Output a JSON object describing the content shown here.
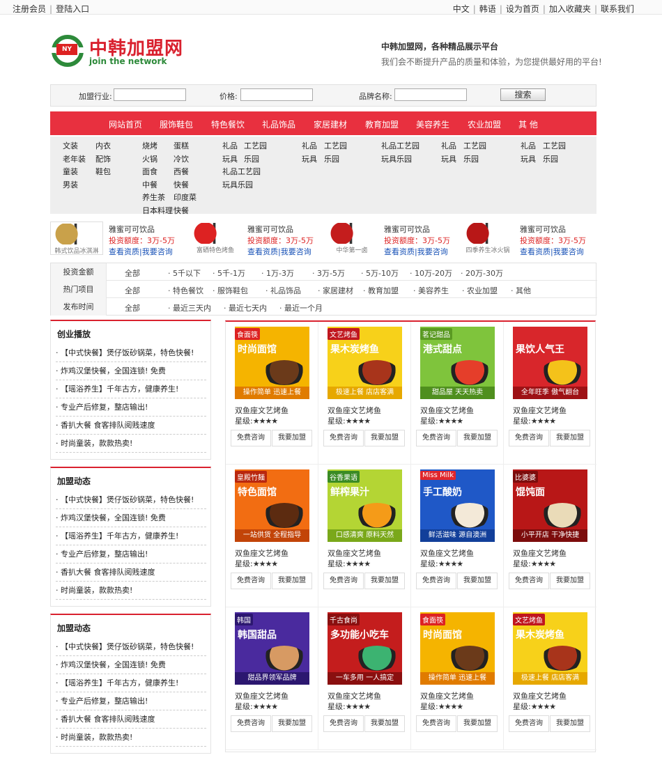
{
  "topbar": {
    "left": [
      "注册会员",
      "登陆入口"
    ],
    "right": [
      "中文",
      "韩语",
      "设为首页",
      "加入收藏夹",
      "联系我们"
    ]
  },
  "logo": {
    "cn": "中韩加盟网",
    "en": "join the network",
    "badge": "NY"
  },
  "slogan": {
    "title": "中韩加盟网，各种精品展示平台",
    "sub": "我们会不断提升产品的质量和体验，为您提供最好用的平台!"
  },
  "search": {
    "industry_label": "加盟行业:",
    "price_label": "价格:",
    "brand_label": "品牌名称:",
    "button": "搜索"
  },
  "nav": [
    "网站首页",
    "服饰鞋包",
    "特色餐饮",
    "礼品饰品",
    "家居建材",
    "教育加盟",
    "美容养生",
    "农业加盟",
    "其 他"
  ],
  "subnav": {
    "c1": [
      [
        "文装",
        "内衣"
      ],
      [
        "老年装",
        "配饰"
      ],
      [
        "童装",
        "鞋包"
      ],
      [
        "男装",
        ""
      ]
    ],
    "c2": [
      [
        "烧烤",
        "蛋糕"
      ],
      [
        "火锅",
        "冷饮"
      ],
      [
        "面食",
        "西餐"
      ],
      [
        "中餐",
        "快餐"
      ],
      [
        "养生茶",
        "印度菜"
      ],
      [
        "日本料理",
        "快餐"
      ]
    ],
    "c3": [
      [
        "礼品",
        "工艺园"
      ],
      [
        "玩具",
        "乐园"
      ],
      [
        "礼品工艺园",
        ""
      ],
      [
        "玩具乐园",
        ""
      ]
    ],
    "c4": [
      [
        "礼品",
        "工艺园"
      ],
      [
        "玩具",
        "乐园"
      ]
    ],
    "c5": [
      [
        "礼品工艺园",
        ""
      ],
      [
        "玩具乐园",
        ""
      ]
    ],
    "c6": [
      [
        "礼品",
        "工艺园"
      ],
      [
        "玩具",
        "乐园"
      ]
    ],
    "c7": [
      [
        "礼品",
        "工艺园"
      ],
      [
        "玩具",
        "乐园"
      ]
    ]
  },
  "brands": [
    {
      "caption": "韩式饮品冰淇淋",
      "name": "雅蜜可可饮品",
      "amount": "投资额度：3万-5万",
      "link1": "查看资质",
      "link2": "我要咨询"
    },
    {
      "caption": "富硒特色烤鱼",
      "name": "雅蜜可可饮品",
      "amount": "投资额度：3万-5万",
      "link1": "查看资质",
      "link2": "我要咨询"
    },
    {
      "caption": "中华第一卤",
      "name": "雅蜜可可饮品",
      "amount": "投资额度：3万-5万",
      "link1": "查看资质",
      "link2": "我要咨询"
    },
    {
      "caption": "四季养生冰火锅",
      "name": "雅蜜可可饮品",
      "amount": "投资额度：3万-5万",
      "link1": "查看资质",
      "link2": "我要咨询"
    }
  ],
  "filter": [
    {
      "label": "投资金额",
      "opts": [
        "全部",
        "· 5千以下",
        "· 5千-1万",
        "· 1万-3万",
        "· 3万-5万",
        "· 5万-10万",
        "· 10万-20万",
        "· 20万-30万"
      ]
    },
    {
      "label": "热门项目",
      "opts": [
        "全部",
        "· 特色餐饮",
        "· 服饰鞋包",
        "· 礼品饰品",
        "· 家居建材",
        "· 教育加盟",
        "· 美容养生",
        "· 农业加盟",
        "· 其他"
      ]
    },
    {
      "label": "发布时间",
      "opts": [
        "全部",
        "· 最近三天内",
        "· 最近七天内",
        "· 最近一个月"
      ]
    }
  ],
  "panels": [
    {
      "title": "创业播放",
      "items": [
        "【中式快餐】煲仔饭砂锅菜，特色快餐!",
        "炸鸡汉堡快餐，全国连锁! 免费",
        "【瑶浴养生】千年古方，健康养生!",
        "专业产后修复，整店输出!",
        "香扒大餐 食客排队阅贱速度",
        "时尚童装，款款热卖!"
      ]
    },
    {
      "title": "加盟动态",
      "items": [
        "【中式快餐】煲仔饭砂锅菜，特色快餐!",
        "炸鸡汉堡快餐，全国连锁! 免费",
        "【瑶浴养生】千年古方，健康养生!",
        "专业产后修复，整店输出!",
        "香扒大餐 食客排队阅贱速度",
        "时尚童装，款款热卖!"
      ]
    },
    {
      "title": "加盟动态",
      "items": [
        "【中式快餐】煲仔饭砂锅菜，特色快餐!",
        "炸鸡汉堡快餐，全国连锁! 免费",
        "【瑶浴养生】千年古方，健康养生!",
        "专业产后修复，整店输出!",
        "香扒大餐 食客排队阅贱速度",
        "时尚童装，款款热卖!"
      ]
    }
  ],
  "products": [
    {
      "tag": "食面筷",
      "title": "时尚面馆",
      "foot": "操作简单 迅速上餐",
      "bg": "#f5b400",
      "tagbg": "#d22",
      "bowl": "#6b3a1a",
      "footbg": "#e07b00",
      "name": "双鱼座文艺烤鱼",
      "star_label": "星级:",
      "stars": "★★★★",
      "btn1": "免费咨询",
      "btn2": "我要加盟"
    },
    {
      "tag": "文艺烤鱼",
      "title": "果木炭烤鱼",
      "foot": "极速上餐 店店客满",
      "bg": "#f7d11a",
      "tagbg": "#c0161e",
      "bowl": "#a8341b",
      "footbg": "#e6a800",
      "name": "双鱼座文艺烤鱼",
      "star_label": "星级:",
      "stars": "★★★★",
      "btn1": "免费咨询",
      "btn2": "我要加盟"
    },
    {
      "tag": "茗记甜品",
      "title": "港式甜点",
      "foot": "甜品屋 天天热卖",
      "bg": "#7fc43c",
      "tagbg": "#5a9a22",
      "bowl": "#e53e2a",
      "footbg": "#4f8f1e",
      "name": "双鱼座文艺烤鱼",
      "star_label": "星级:",
      "stars": "★★★★",
      "btn1": "免费咨询",
      "btn2": "我要加盟"
    },
    {
      "tag": "",
      "title": "果饮人气王",
      "foot": "全年旺季 傲气翻台",
      "bg": "#d8262b",
      "tagbg": "#d8262b",
      "bowl": "#f4c21a",
      "footbg": "#9e1115",
      "name": "双鱼座文艺烤鱼",
      "star_label": "星级:",
      "stars": "★★★★",
      "btn1": "免费咨询",
      "btn2": "我要加盟"
    },
    {
      "tag": "皇殿竹麺",
      "title": "特色面馆",
      "foot": "一站供货 全程指导",
      "bg": "#f26d12",
      "tagbg": "#b9270e",
      "bowl": "#5c2b10",
      "footbg": "#c24408",
      "name": "双鱼座文艺烤鱼",
      "star_label": "星级:",
      "stars": "★★★★",
      "btn1": "免费咨询",
      "btn2": "我要加盟"
    },
    {
      "tag": "谷香果语",
      "title": "鲜榨果汁",
      "foot": "口感清爽 原料天然",
      "bg": "#b4d534",
      "tagbg": "#3a8b24",
      "bowl": "#f59b18",
      "footbg": "#7aa81a",
      "name": "双鱼座文艺烤鱼",
      "star_label": "星级:",
      "stars": "★★★★",
      "btn1": "免费咨询",
      "btn2": "我要加盟"
    },
    {
      "tag": "Miss Milk",
      "title": "手工酸奶",
      "foot": "鲜活滋味 源自澳洲",
      "bg": "#1f58c7",
      "tagbg": "#e0262c",
      "bowl": "#f3e9d8",
      "footbg": "#123f9a",
      "name": "双鱼座文艺烤鱼",
      "star_label": "星级:",
      "stars": "★★★★",
      "btn1": "免费咨询",
      "btn2": "我要加盟"
    },
    {
      "tag": "比婆婆",
      "title": "馄饨面",
      "foot": "小平开店 干净快捷",
      "bg": "#b81717",
      "tagbg": "#7c0c0c",
      "bowl": "#eadbb8",
      "footbg": "#7c0c0c",
      "name": "双鱼座文艺烤鱼",
      "star_label": "星级:",
      "stars": "★★★★",
      "btn1": "免费咨询",
      "btn2": "我要加盟"
    },
    {
      "tag": "韩国",
      "title": "韩国甜品",
      "foot": "甜品界领军品牌",
      "bg": "#4a2a9e",
      "tagbg": "#2c1770",
      "bowl": "#d79a63",
      "footbg": "#2c1770",
      "name": "双鱼座文艺烤鱼",
      "star_label": "星级:",
      "stars": "★★★★",
      "btn1": "免费咨询",
      "btn2": "我要加盟"
    },
    {
      "tag": "千古食尚",
      "title": "多功能小吃车",
      "foot": "一车多用 一人搞定",
      "bg": "#c41d1d",
      "tagbg": "#8a0f0f",
      "bowl": "#3cb371",
      "footbg": "#8a0f0f",
      "name": "双鱼座文艺烤鱼",
      "star_label": "星级:",
      "stars": "★★★★",
      "btn1": "免费咨询",
      "btn2": "我要加盟"
    },
    {
      "tag": "食面筷",
      "title": "时尚面馆",
      "foot": "操作简单 迅速上餐",
      "bg": "#f5b400",
      "tagbg": "#d22",
      "bowl": "#6b3a1a",
      "footbg": "#e07b00",
      "name": "双鱼座文艺烤鱼",
      "star_label": "星级:",
      "stars": "★★★★",
      "btn1": "免费咨询",
      "btn2": "我要加盟"
    },
    {
      "tag": "文艺烤鱼",
      "title": "果木炭烤鱼",
      "foot": "极速上餐 店店客满",
      "bg": "#f7d11a",
      "tagbg": "#c0161e",
      "bowl": "#a8341b",
      "footbg": "#e6a800",
      "name": "双鱼座文艺烤鱼",
      "star_label": "星级:",
      "stars": "★★★★",
      "btn1": "免费咨询",
      "btn2": "我要加盟"
    }
  ]
}
